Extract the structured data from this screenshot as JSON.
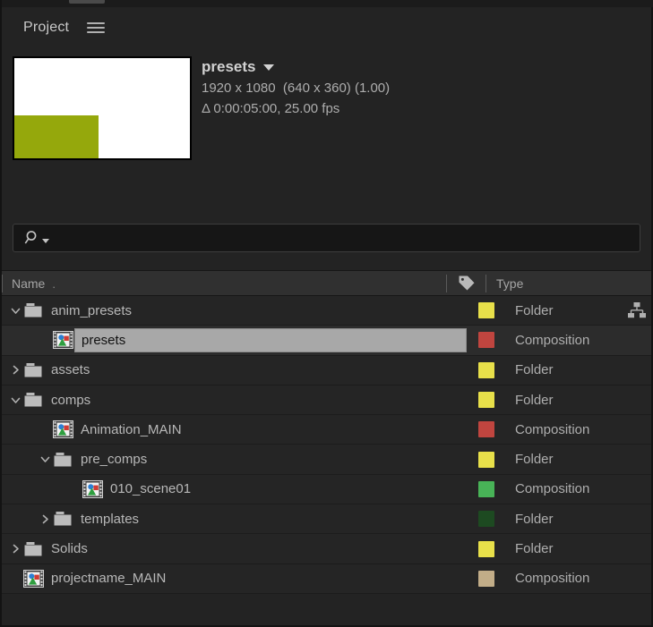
{
  "panel": {
    "title": "Project",
    "menu_icon": "hamburger-menu-icon"
  },
  "preview": {
    "thumbnail_bg": "#ffffff",
    "thumbnail_shape_color": "#95a80c",
    "item_name": "presets",
    "dimensions_line": "1920 x 1080  (640 x 360) (1.00)",
    "duration_line": "Δ 0:00:05:00, 25.00 fps"
  },
  "search": {
    "value": "",
    "placeholder": "",
    "icon": "magnifier-icon"
  },
  "columns": {
    "name": "Name",
    "sort_indicator": ".",
    "label_icon": "tag-icon",
    "type": "Type"
  },
  "colors": {
    "label_yellow": "#e8e04a",
    "label_red": "#c0453f",
    "label_green": "#48b357",
    "label_dark_green": "#1d4a21",
    "label_tan": "#c2ad88",
    "panel_bg": "#232323",
    "row_bg": "#252525",
    "selected_bg": "#2c2c2c",
    "selection_box": "#a8a8a8"
  },
  "rows": [
    {
      "name": "anim_presets",
      "type": "Folder",
      "icon": "folder-icon",
      "indent": 0,
      "twisty": "expanded",
      "label_color": "#e8e04a",
      "selected": false,
      "extra_icon": "hierarchy-icon"
    },
    {
      "name": "presets",
      "type": "Composition",
      "icon": "composition-icon",
      "indent": 1,
      "twisty": "none",
      "label_color": "#c0453f",
      "selected": true,
      "extra_icon": ""
    },
    {
      "name": "assets",
      "type": "Folder",
      "icon": "folder-icon",
      "indent": 0,
      "twisty": "collapsed",
      "label_color": "#e8e04a",
      "selected": false,
      "extra_icon": ""
    },
    {
      "name": "comps",
      "type": "Folder",
      "icon": "folder-icon",
      "indent": 0,
      "twisty": "expanded",
      "label_color": "#e8e04a",
      "selected": false,
      "extra_icon": ""
    },
    {
      "name": "Animation_MAIN",
      "type": "Composition",
      "icon": "composition-icon",
      "indent": 1,
      "twisty": "none",
      "label_color": "#c0453f",
      "selected": false,
      "extra_icon": ""
    },
    {
      "name": "pre_comps",
      "type": "Folder",
      "icon": "folder-icon",
      "indent": 1,
      "twisty": "expanded",
      "label_color": "#e8e04a",
      "selected": false,
      "extra_icon": ""
    },
    {
      "name": "010_scene01",
      "type": "Composition",
      "icon": "composition-icon",
      "indent": 2,
      "twisty": "none",
      "label_color": "#48b357",
      "selected": false,
      "extra_icon": ""
    },
    {
      "name": "templates",
      "type": "Folder",
      "icon": "folder-icon",
      "indent": 1,
      "twisty": "collapsed",
      "label_color": "#1d4a21",
      "selected": false,
      "extra_icon": ""
    },
    {
      "name": "Solids",
      "type": "Folder",
      "icon": "folder-icon",
      "indent": 0,
      "twisty": "collapsed",
      "label_color": "#e8e04a",
      "selected": false,
      "extra_icon": ""
    },
    {
      "name": "projectname_MAIN",
      "type": "Composition",
      "icon": "composition-icon",
      "indent": 0,
      "twisty": "none",
      "label_color": "#c2ad88",
      "selected": false,
      "extra_icon": ""
    }
  ]
}
